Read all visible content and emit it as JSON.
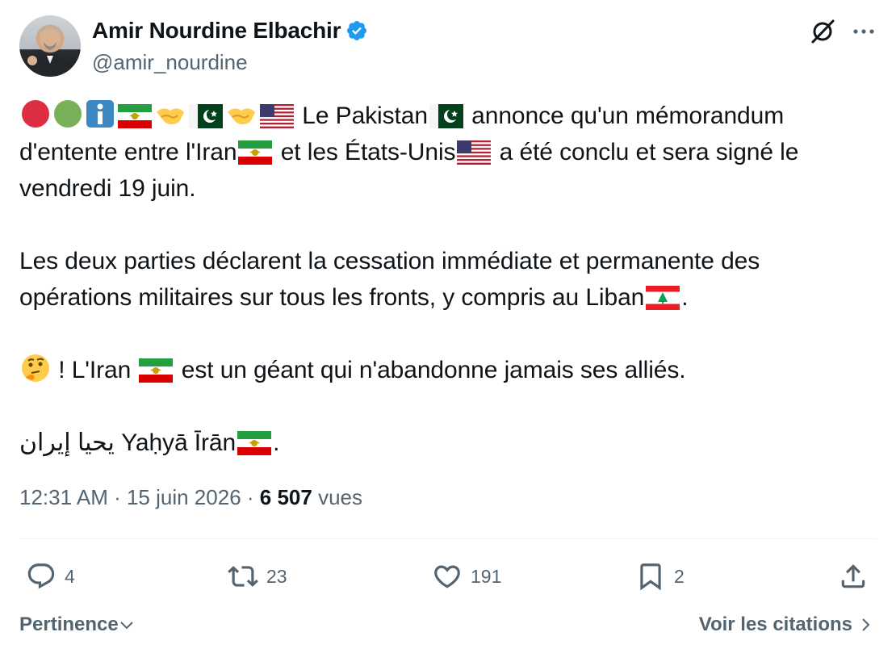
{
  "author": {
    "display_name": "Amir Nourdine Elbachir",
    "handle": "@amir_nourdine",
    "verified": true
  },
  "tweet": {
    "line1": "Le Pakistan",
    "line1b": "annonce qu'un mémorandum",
    "line2a": "d'entente entre l'Iran",
    "line2b": "et les États-Unis",
    "line2c": "a été conclu et sera signé le",
    "line3": "vendredi 19 juin.",
    "line4": "Les deux parties déclarent la cessation immédiate et permanente des",
    "line5": "opérations militaires sur tous les fronts, y compris au Liban",
    "line5_end": ".",
    "line6a": "! L'Iran",
    "line6b": "est un géant qui n'abandonne jamais ses alliés.",
    "line7_arabic": "يحيا إيران",
    "line7_latin": "Yaḥyā Īrān",
    "line7_end": "."
  },
  "meta": {
    "time": "12:31 AM",
    "sep1": " · ",
    "date": "15 juin 2026",
    "sep2": " · ",
    "views_count": "6 507",
    "views_label": " vues"
  },
  "actions": {
    "replies": "4",
    "reposts": "23",
    "likes": "191",
    "bookmarks": "2"
  },
  "footer": {
    "sort_label": "Pertinence",
    "quotes_label": "Voir les citations"
  },
  "colors": {
    "text": "#0f1419",
    "secondary": "#536471",
    "verified": "#1d9bf0",
    "divider": "#eff3f4"
  }
}
